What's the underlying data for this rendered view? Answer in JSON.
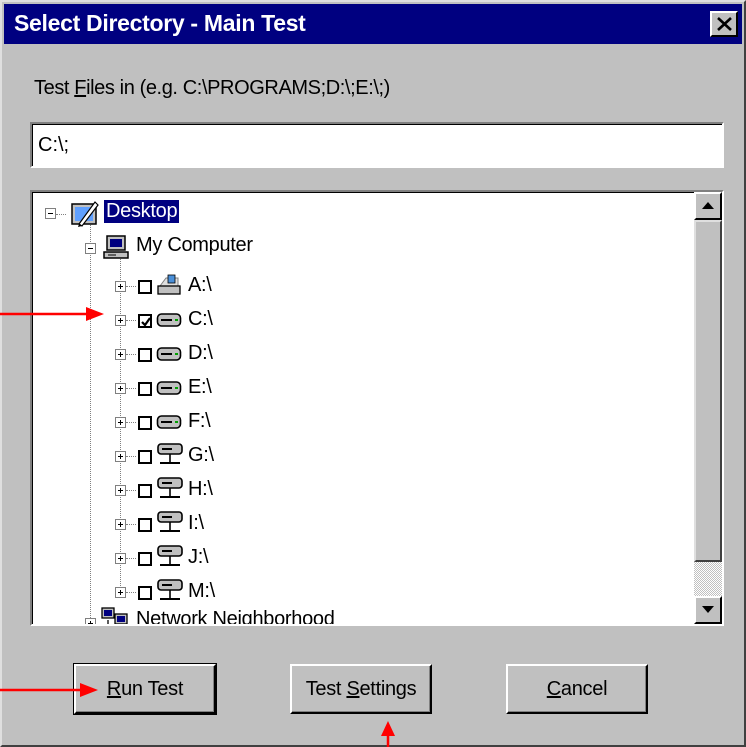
{
  "window": {
    "title": "Select Directory - Main Test",
    "close_glyph": "✕"
  },
  "prompt": {
    "label_pre": "Test ",
    "label_mnemonic": "F",
    "label_post": "iles in (e.g. C:\\PROGRAMS;D:\\;E:\\;)"
  },
  "path_field": {
    "value": "C:\\;"
  },
  "tree": {
    "root": {
      "label": "Desktop",
      "icon": "desktop-icon",
      "selected": true
    },
    "computer": {
      "label": "My Computer",
      "icon": "computer-icon"
    },
    "drives": [
      {
        "label": "A:\\",
        "icon": "floppy-drive-icon",
        "checked": false
      },
      {
        "label": "C:\\",
        "icon": "hard-drive-icon",
        "checked": true
      },
      {
        "label": "D:\\",
        "icon": "hard-drive-icon",
        "checked": false
      },
      {
        "label": "E:\\",
        "icon": "hard-drive-icon",
        "checked": false
      },
      {
        "label": "F:\\",
        "icon": "hard-drive-icon",
        "checked": false
      },
      {
        "label": "G:\\",
        "icon": "network-drive-icon",
        "checked": false
      },
      {
        "label": "H:\\",
        "icon": "network-drive-icon",
        "checked": false
      },
      {
        "label": "I:\\",
        "icon": "network-drive-icon",
        "checked": false
      },
      {
        "label": "J:\\",
        "icon": "network-drive-icon",
        "checked": false
      },
      {
        "label": "M:\\",
        "icon": "network-drive-icon",
        "checked": false
      }
    ],
    "network": {
      "label": "Network Neighborhood",
      "icon": "network-neighborhood-icon"
    }
  },
  "buttons": {
    "run_test": {
      "pre": "",
      "mnemonic": "R",
      "post": "un Test"
    },
    "test_settings": {
      "pre": "Test ",
      "mnemonic": "S",
      "post": "ettings"
    },
    "cancel": {
      "pre": "",
      "mnemonic": "C",
      "post": "ancel"
    }
  },
  "colors": {
    "titlebar": "#000080",
    "face": "#c0c0c0",
    "annotation_arrow": "#ff0000"
  }
}
